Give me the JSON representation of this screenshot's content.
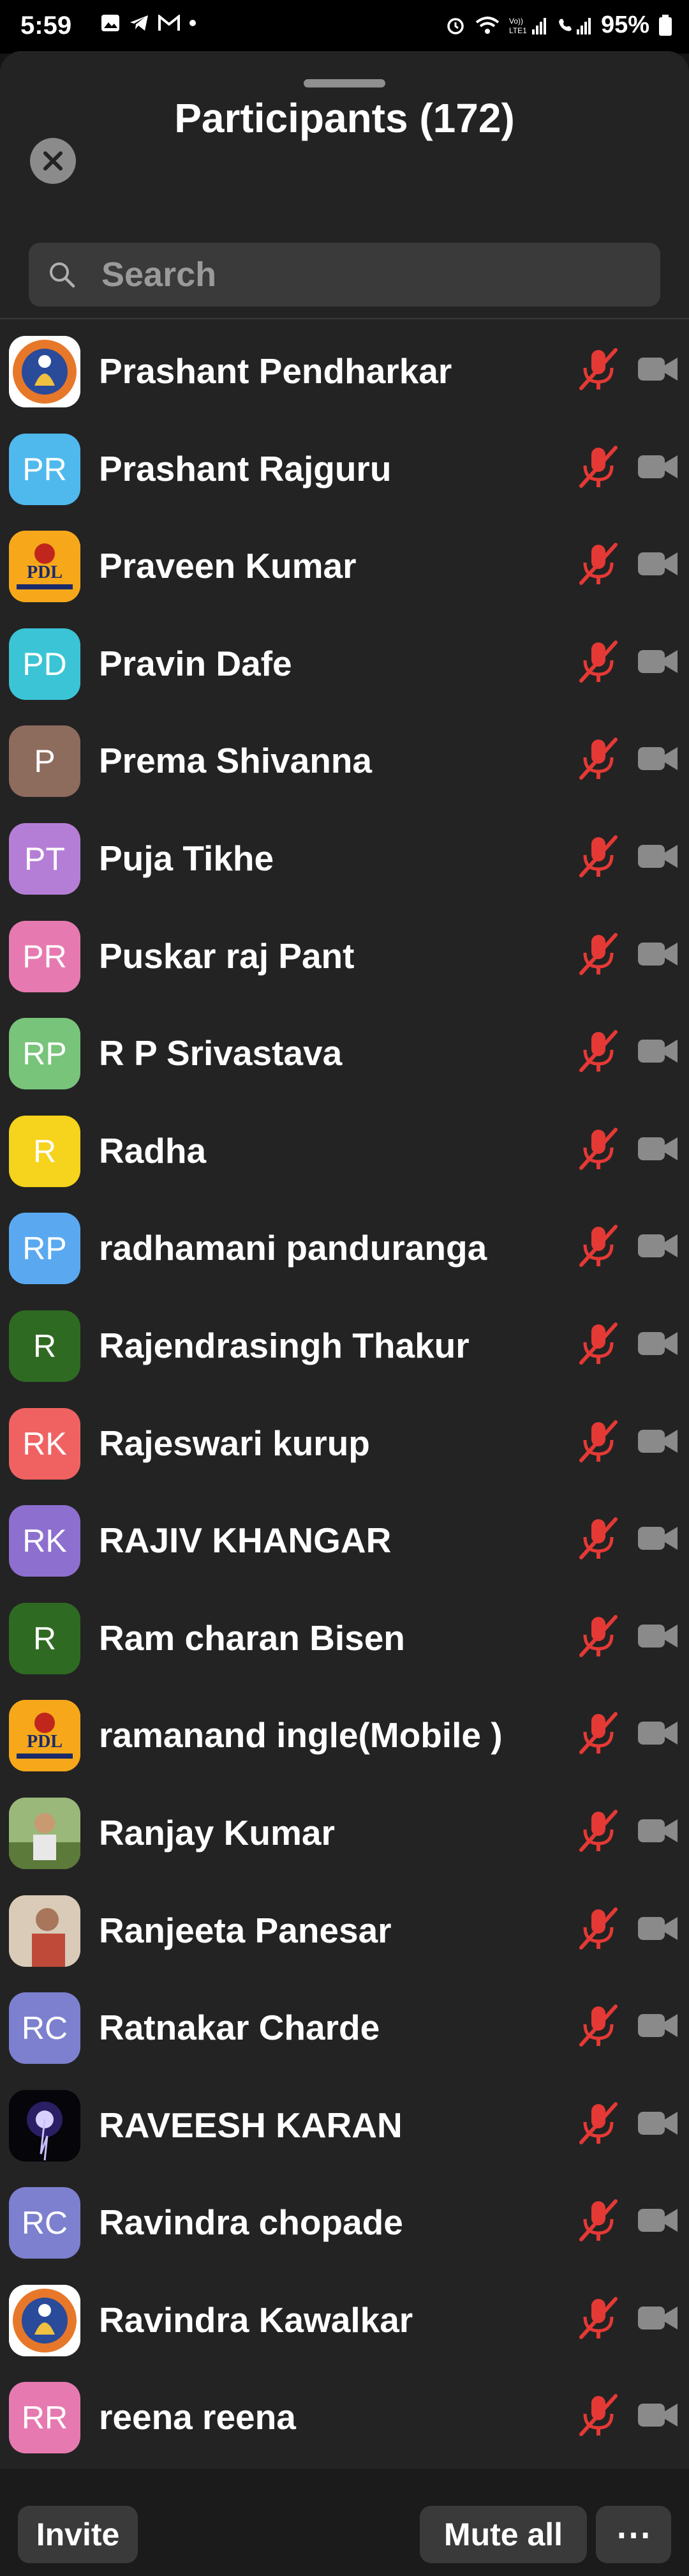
{
  "status": {
    "time": "5:59",
    "battery": "95%"
  },
  "header": {
    "title": "Participants (172)"
  },
  "search": {
    "placeholder": "Search"
  },
  "participants": [
    {
      "name": "Prashant Pendharkar",
      "initials": "",
      "avatar_color": "#ffffff",
      "avatar_type": "logo-orange"
    },
    {
      "name": "Prashant Rajguru",
      "initials": "PR",
      "avatar_color": "#4fb9ee",
      "avatar_type": "initials"
    },
    {
      "name": "Praveen Kumar",
      "initials": "",
      "avatar_color": "#f7a81a",
      "avatar_type": "logo-pdl"
    },
    {
      "name": "Pravin Dafe",
      "initials": "PD",
      "avatar_color": "#3bc4d6",
      "avatar_type": "initials"
    },
    {
      "name": "Prema Shivanna",
      "initials": "P",
      "avatar_color": "#8d6b5d",
      "avatar_type": "initials"
    },
    {
      "name": "Puja Tikhe",
      "initials": "PT",
      "avatar_color": "#b57ed6",
      "avatar_type": "initials"
    },
    {
      "name": "Puskar raj Pant",
      "initials": "PR",
      "avatar_color": "#e67ab0",
      "avatar_type": "initials"
    },
    {
      "name": "R P Srivastava",
      "initials": "RP",
      "avatar_color": "#78c47a",
      "avatar_type": "initials"
    },
    {
      "name": "Radha",
      "initials": "R",
      "avatar_color": "#f6d31c",
      "avatar_type": "initials"
    },
    {
      "name": "radhamani panduranga",
      "initials": "RP",
      "avatar_color": "#5aa9f0",
      "avatar_type": "initials"
    },
    {
      "name": "Rajendrasingh Thakur",
      "initials": "R",
      "avatar_color": "#2f6a22",
      "avatar_type": "initials"
    },
    {
      "name": "Rajeswari kurup",
      "initials": "RK",
      "avatar_color": "#f06262",
      "avatar_type": "initials"
    },
    {
      "name": "RAJIV KHANGAR",
      "initials": "RK",
      "avatar_color": "#8d6fcf",
      "avatar_type": "initials"
    },
    {
      "name": "Ram charan Bisen",
      "initials": "R",
      "avatar_color": "#2f6a22",
      "avatar_type": "initials"
    },
    {
      "name": "ramanand ingle(Mobile )",
      "initials": "",
      "avatar_color": "#f7a81a",
      "avatar_type": "logo-pdl"
    },
    {
      "name": "Ranjay Kumar",
      "initials": "",
      "avatar_color": "#7a9a5a",
      "avatar_type": "photo-outdoor"
    },
    {
      "name": "Ranjeeta Panesar",
      "initials": "",
      "avatar_color": "#b08a70",
      "avatar_type": "photo-person"
    },
    {
      "name": "Ratnakar Charde",
      "initials": "RC",
      "avatar_color": "#7d80cf",
      "avatar_type": "initials"
    },
    {
      "name": "RAVEESH KARAN",
      "initials": "",
      "avatar_color": "#000000",
      "avatar_type": "photo-lightning"
    },
    {
      "name": "Ravindra chopade",
      "initials": "RC",
      "avatar_color": "#7d80cf",
      "avatar_type": "initials"
    },
    {
      "name": "Ravindra Kawalkar",
      "initials": "",
      "avatar_color": "#ffffff",
      "avatar_type": "logo-orange"
    },
    {
      "name": "reena reena",
      "initials": "RR",
      "avatar_color": "#e67ab0",
      "avatar_type": "initials"
    }
  ],
  "footer": {
    "invite_label": "Invite",
    "mute_all_label": "Mute all",
    "more_label": "⋯"
  },
  "colors": {
    "mic_muted": "#e53935",
    "camera_off": "#8a8a8a",
    "sheet_bg": "#232323",
    "button_bg": "#3a3a3a"
  }
}
